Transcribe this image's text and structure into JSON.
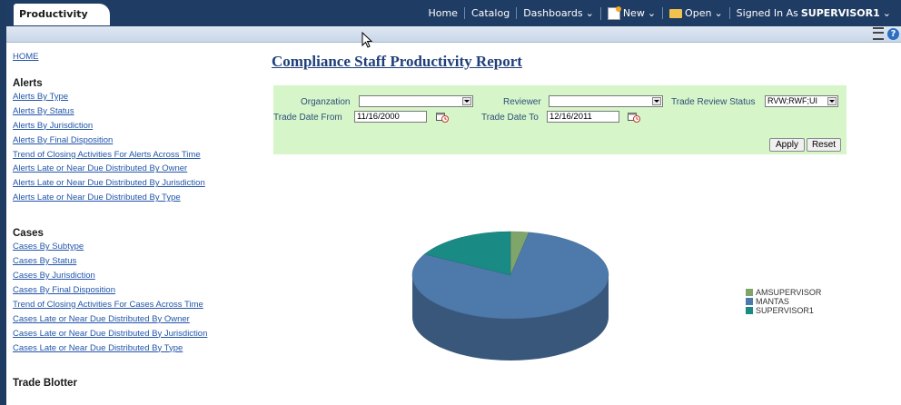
{
  "app": {
    "tab_label": "Productivity"
  },
  "menu": {
    "home": "Home",
    "catalog": "Catalog",
    "dashboards": "Dashboards",
    "new": "New",
    "open": "Open",
    "signed_in_prefix": "Signed In As",
    "user": "SUPERVISOR1"
  },
  "sidebar": {
    "home": "HOME",
    "alerts": {
      "title": "Alerts",
      "items": [
        "Alerts By Type",
        "Alerts By Status",
        "Alerts By Jurisdiction",
        "Alerts By Final Disposition",
        "Trend of Closing Activities For Alerts Across Time",
        "Alerts Late or Near Due Distributed By Owner",
        "Alerts Late or Near Due Distributed By Jurisdiction",
        "Alerts Late or Near Due Distributed By Type"
      ]
    },
    "cases": {
      "title": "Cases",
      "items": [
        "Cases By Subtype",
        "Cases By Status",
        "Cases By Jurisdiction",
        "Cases By Final Disposition",
        "Trend of Closing Activities For Cases Across Time",
        "Cases Late or Near Due Distributed By Owner",
        "Cases Late or Near Due Distributed By Jurisdiction",
        "Cases Late or Near Due Distributed By Type"
      ]
    },
    "trade_blotter": {
      "title": "Trade Blotter"
    }
  },
  "report": {
    "title": "Compliance Staff Productivity Report"
  },
  "filters": {
    "organization_label": "Organzation",
    "organization_value": "",
    "reviewer_label": "Reviewer",
    "reviewer_value": "",
    "trade_review_status_label": "Trade Review Status",
    "trade_review_status_value": "RVW;RWF;UI",
    "trade_date_from_label": "Trade Date From",
    "trade_date_from_value": "11/16/2000",
    "trade_date_to_label": "Trade Date To",
    "trade_date_to_value": "12/16/2011",
    "apply_label": "Apply",
    "reset_label": "Reset"
  },
  "colors": {
    "topbar": "#1f3c64",
    "filter_bg": "#d6f5c8",
    "amsupervisor": "#7fa56b",
    "mantas": "#4e79ab",
    "supervisor1": "#1a8a84"
  },
  "chart_data": {
    "type": "pie",
    "three_d": true,
    "title": "",
    "legend_position": "right",
    "slices": [
      {
        "name": "AMSUPERVISOR",
        "value": 3
      },
      {
        "name": "MANTAS",
        "value": 80
      },
      {
        "name": "SUPERVISOR1",
        "value": 17
      }
    ]
  }
}
